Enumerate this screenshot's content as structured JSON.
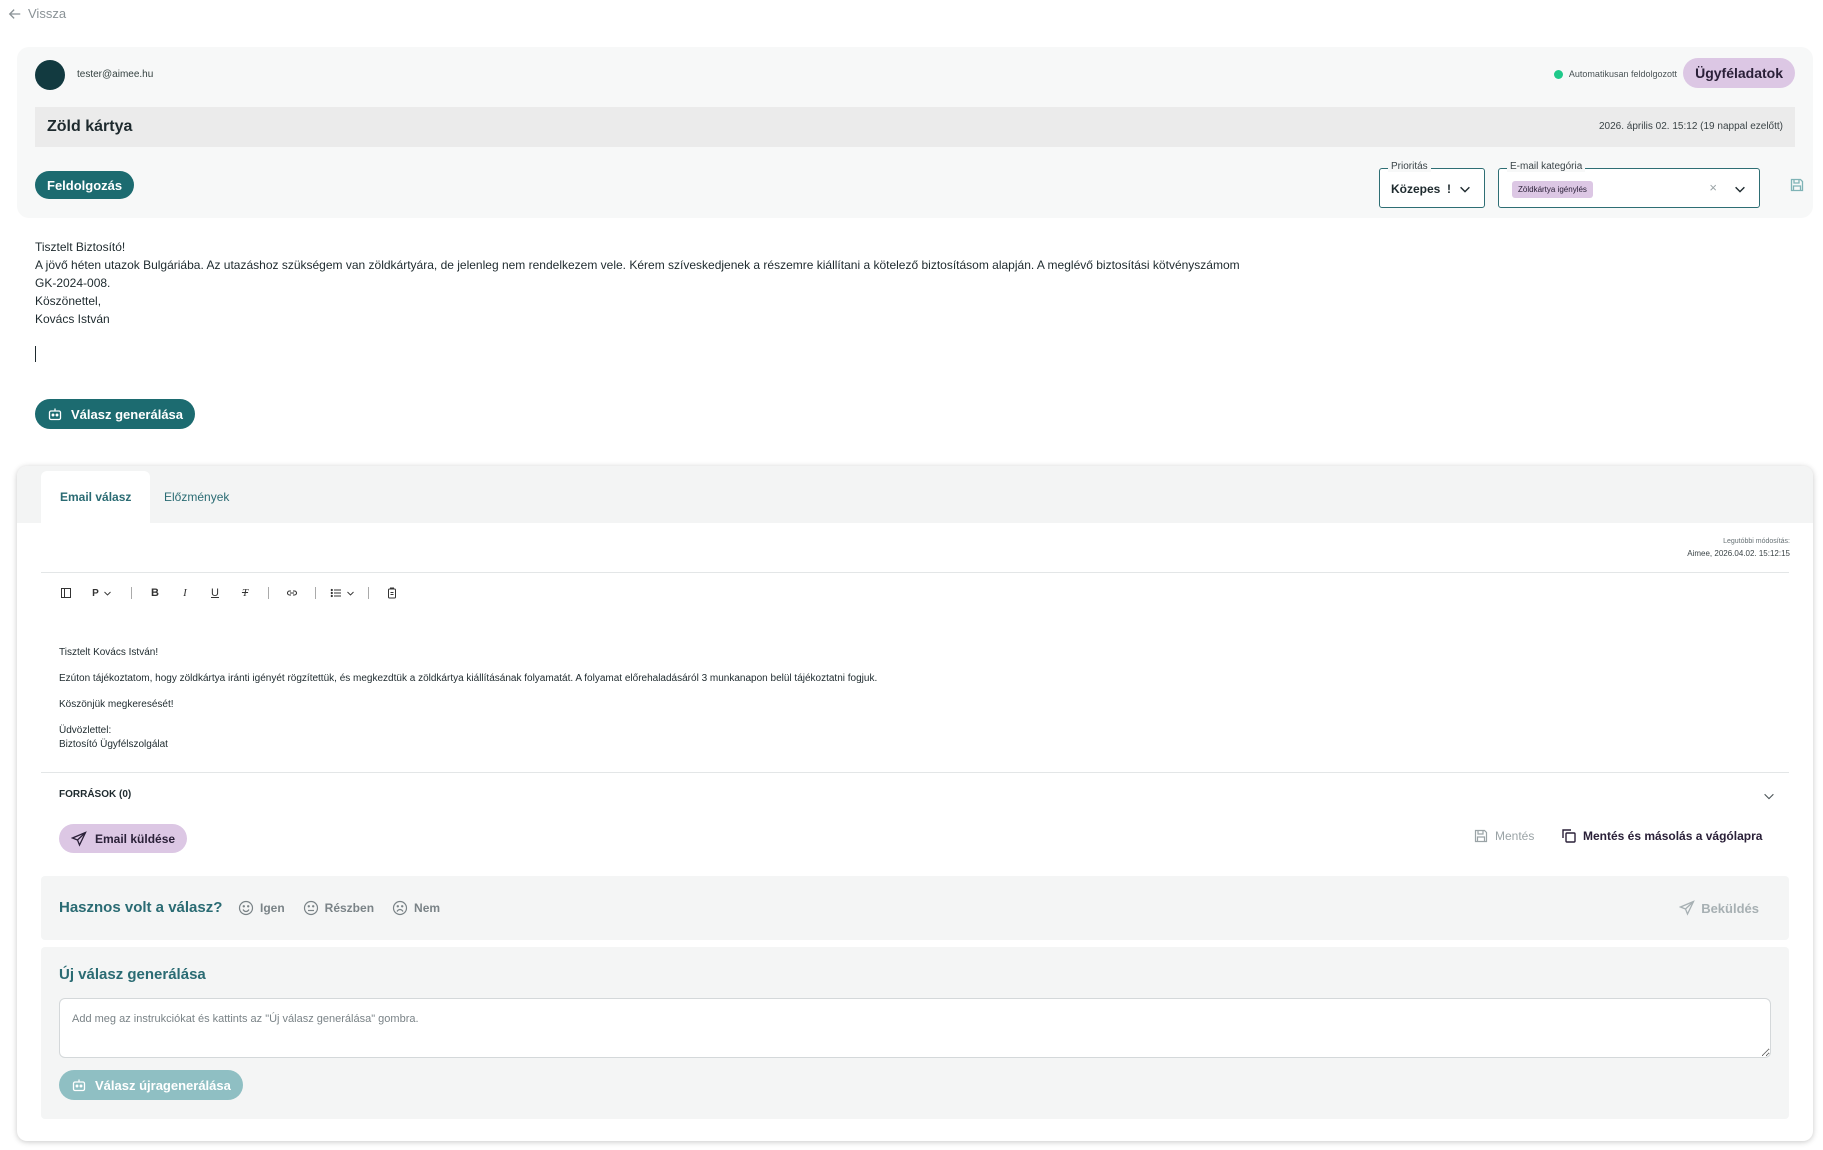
{
  "nav": {
    "back_label": "Vissza"
  },
  "header": {
    "sender": "tester@aimee.hu",
    "status_text": "Automatikusan feldolgozott",
    "customer_button": "Ügyféladatok"
  },
  "subject": {
    "title": "Zöld kártya",
    "date": "2026. április 02. 15:12 (19 nappal ezelőtt)"
  },
  "actions": {
    "process_button": "Feldolgozás"
  },
  "priority": {
    "legend": "Prioritás",
    "value": "Közepes  !"
  },
  "category": {
    "legend": "E-mail kategória",
    "chip": "Zöldkártya igénylés"
  },
  "email_body": [
    "Tisztelt Biztosító!",
    "A jövő héten utazok Bulgáriába. Az utazáshoz szükségem van zöldkártyára, de jelenleg nem rendelkezem vele. Kérem szíveskedjenek a részemre kiállítani a kötelező biztosításom alapján. A meglévő biztosítási kötvényszámom",
    "GK-2024-008.",
    "Köszönettel,",
    "Kovács István"
  ],
  "generate_button": "Válasz generálása",
  "tabs": [
    {
      "label": "Email válasz",
      "active": true
    },
    {
      "label": "Előzmények",
      "active": false
    }
  ],
  "last_modified": {
    "label": "Legutóbbi módosítás:",
    "value": "Aimee, 2026.04.02. 15:12:15"
  },
  "toolbar": {
    "paragraph": "P"
  },
  "reply": {
    "greeting": "Tisztelt Kovács István!",
    "line1": "Ezúton tájékoztatom, hogy zöldkártya iránti igényét rögzítettük, és megkezdtük a zöldkártya kiállításának folyamatát. A folyamat előrehaladásáról 3 munkanapon belül tájékoztatni fogjuk.",
    "line2": "Köszönjük megkeresését!",
    "closing1": "Üdvözlettel:",
    "closing2": "Biztosító Ügyfélszolgálat"
  },
  "sources": {
    "label": "FORRÁSOK (0)"
  },
  "reply_actions": {
    "send": "Email küldése",
    "save": "Mentés",
    "save_copy": "Mentés és másolás a vágólapra"
  },
  "feedback": {
    "question": "Hasznos volt a válasz?",
    "yes": "Igen",
    "partly": "Részben",
    "no": "Nem",
    "submit": "Beküldés"
  },
  "new_reply": {
    "title": "Új válasz generálása",
    "placeholder": "Add meg az instrukciókat és kattints az \"Új válasz generálása\" gombra.",
    "button": "Válasz újragenerálása"
  },
  "colors": {
    "primary": "#1c6b70",
    "accent": "#dcc7e4",
    "status_green": "#1fc98a"
  }
}
